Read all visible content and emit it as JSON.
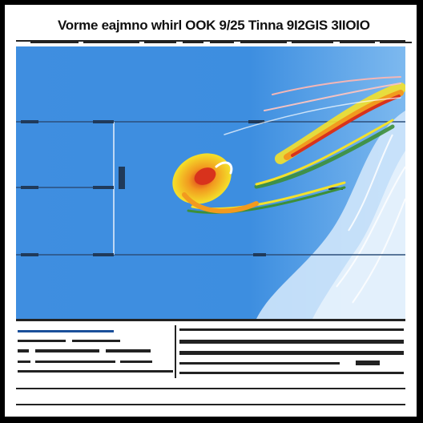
{
  "header": {
    "title": "Vorme eajmno whirl OOK 9/25 Tinna 9I2GIS 3IIOIO"
  },
  "colors": {
    "background": "#000000",
    "page": "#ffffff",
    "plot_sky": "#3f8ee0",
    "plot_light": "#cfe6fb",
    "swirl_yellow": "#f4e12a",
    "swirl_orange": "#f29a1f",
    "swirl_red": "#d8321c",
    "swirl_green": "#3c8f3a",
    "ink": "#111111"
  }
}
